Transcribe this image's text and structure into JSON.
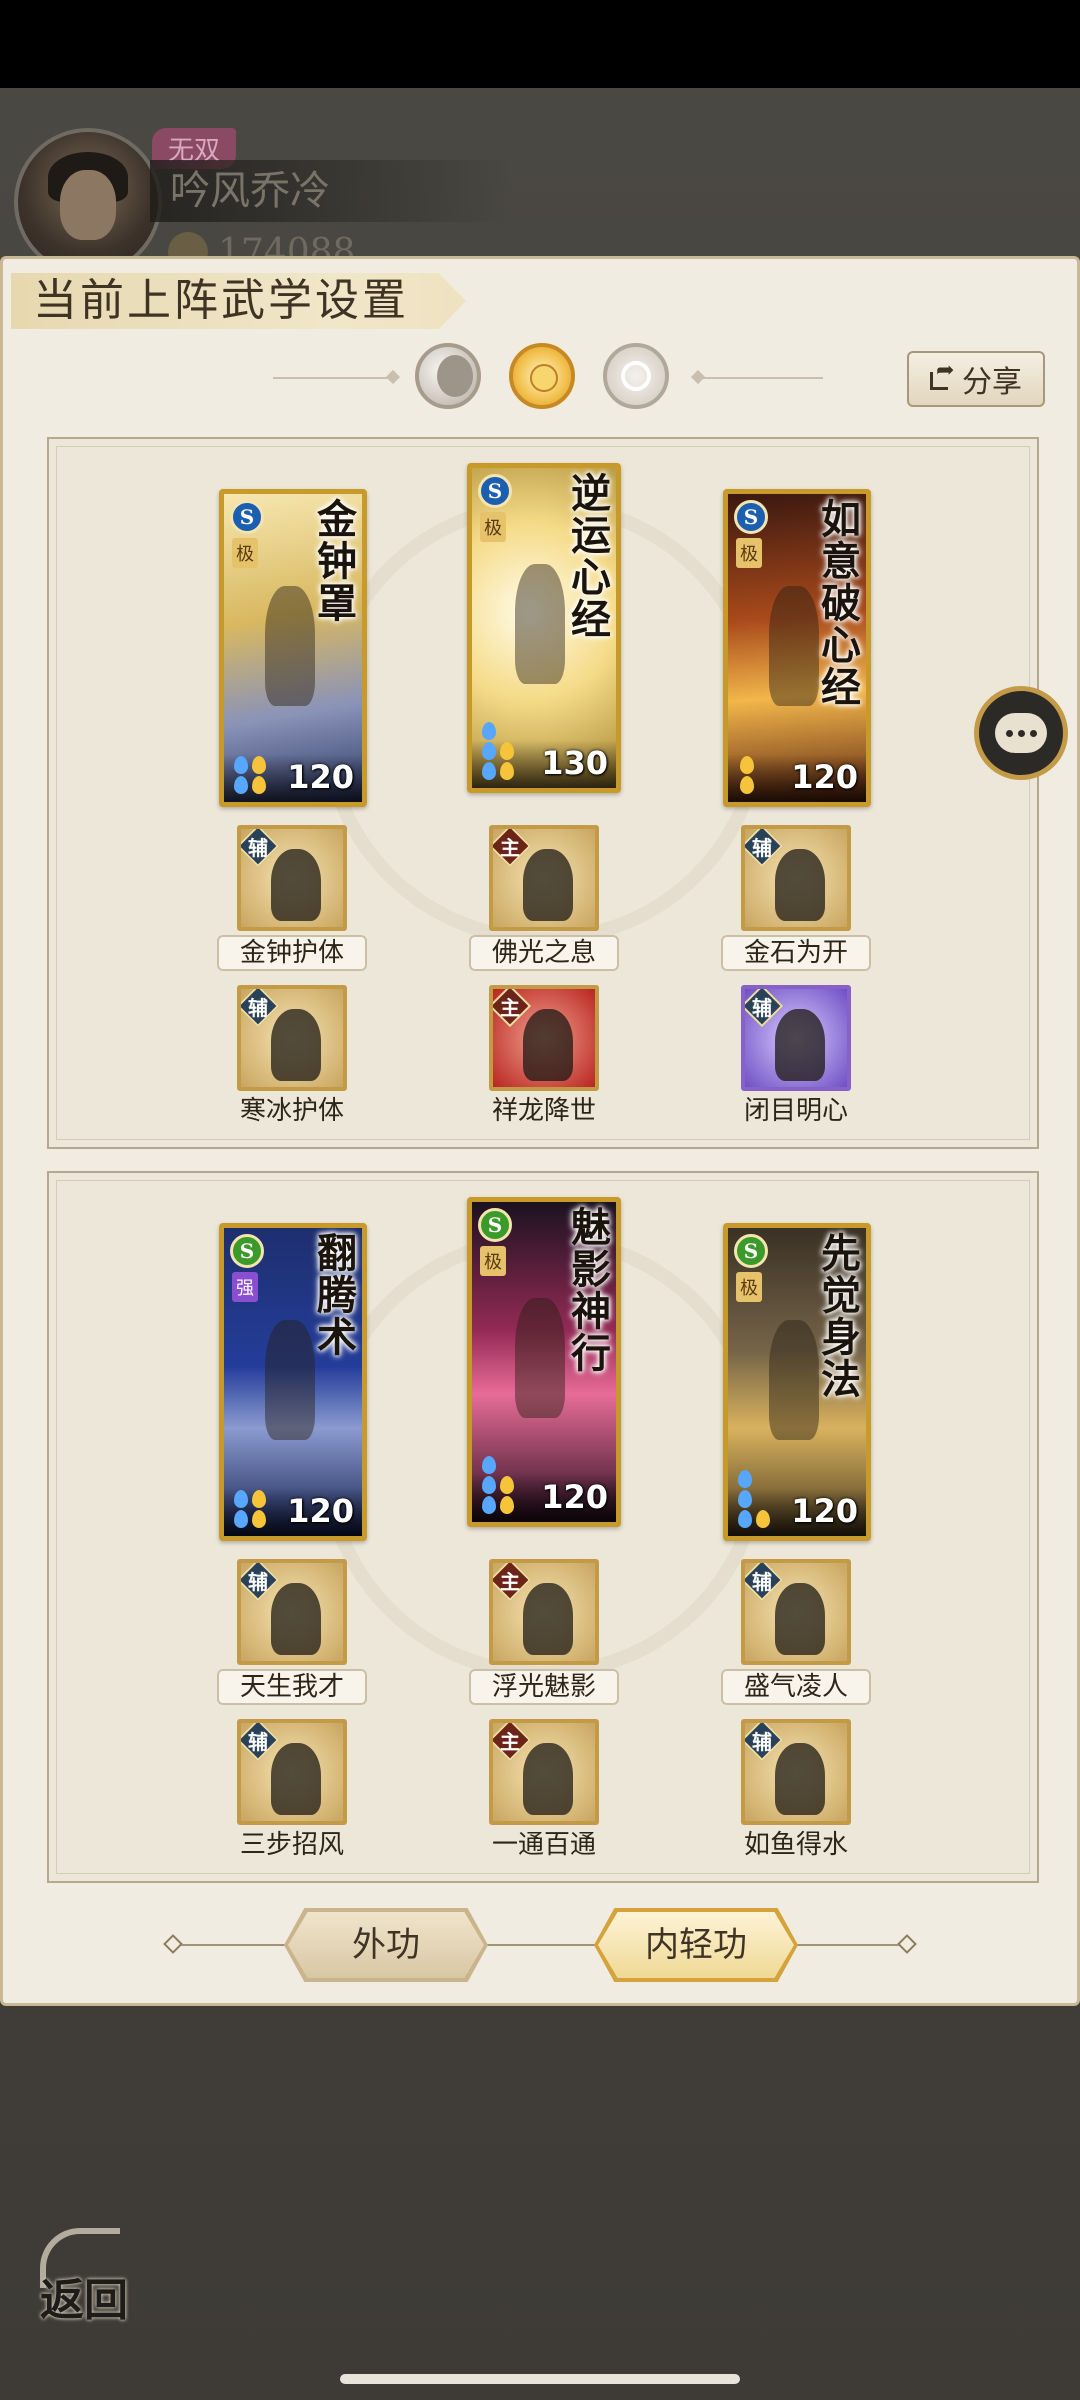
{
  "player": {
    "badge": "无双",
    "name": "吟风乔冷",
    "power": "174088"
  },
  "modal": {
    "title": "当前上阵武学设置",
    "share_label": "分享"
  },
  "panels": [
    {
      "cards": [
        {
          "title": "金钟罩",
          "grade": "极",
          "value": "120"
        },
        {
          "title": "逆运心经",
          "grade": "极",
          "value": "130"
        },
        {
          "title": "如意破心经",
          "grade": "极",
          "value": "120"
        }
      ],
      "skills_row1": [
        {
          "tag": "辅",
          "label": "金钟护体"
        },
        {
          "tag": "主",
          "label": "佛光之息"
        },
        {
          "tag": "辅",
          "label": "金石为开"
        }
      ],
      "skills_row2": [
        {
          "tag": "辅",
          "label": "寒冰护体"
        },
        {
          "tag": "主",
          "label": "祥龙降世"
        },
        {
          "tag": "辅",
          "label": "闭目明心"
        }
      ]
    },
    {
      "cards": [
        {
          "title": "翻腾术",
          "grade": "强",
          "value": "120"
        },
        {
          "title": "魅影神行",
          "grade": "极",
          "value": "120"
        },
        {
          "title": "先觉身法",
          "grade": "极",
          "value": "120"
        }
      ],
      "skills_row1": [
        {
          "tag": "辅",
          "label": "天生我才"
        },
        {
          "tag": "主",
          "label": "浮光魅影"
        },
        {
          "tag": "辅",
          "label": "盛气凌人"
        }
      ],
      "skills_row2": [
        {
          "tag": "辅",
          "label": "三步招风"
        },
        {
          "tag": "主",
          "label": "一通百通"
        },
        {
          "tag": "辅",
          "label": "如鱼得水"
        }
      ]
    }
  ],
  "tabs": {
    "waigong": "外功",
    "neiqing": "内轻功"
  },
  "back_label": "返回",
  "colors": {
    "accent_gold": "#c89a2a",
    "modal_bg": "#f1ece1",
    "assist_tag": "#28425a",
    "main_tag": "#6c2419"
  }
}
